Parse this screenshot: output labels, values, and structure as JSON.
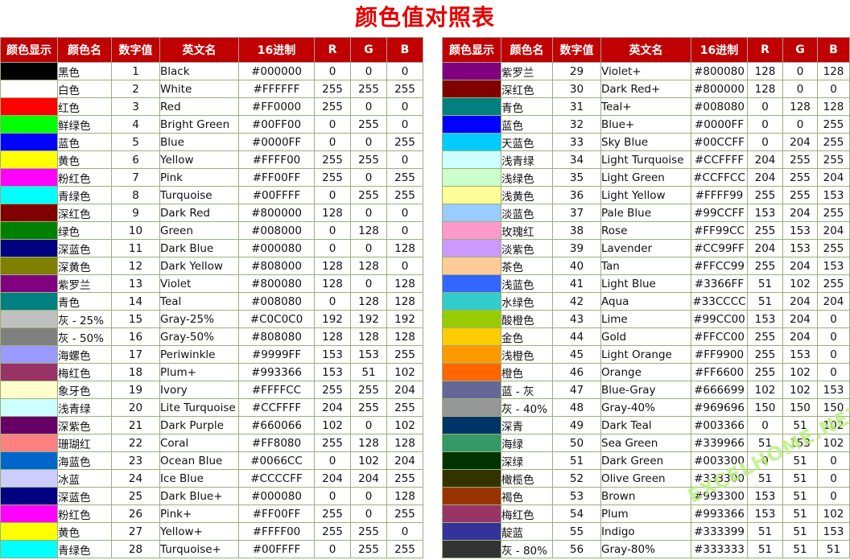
{
  "title": "颜色值对照表",
  "headers": [
    "颜色显示",
    "颜色名",
    "数字值",
    "英文名",
    "16进制",
    "R",
    "G",
    "B"
  ],
  "watermark": "EXCELHOME.NET",
  "rows": [
    {
      "name": "黑色",
      "num": "1",
      "en": "Black",
      "hex": "#000000",
      "r": "0",
      "g": "0",
      "b": "0",
      "color": "#000000"
    },
    {
      "name": "白色",
      "num": "2",
      "en": "White",
      "hex": "#FFFFFF",
      "r": "255",
      "g": "255",
      "b": "255",
      "color": "#FFFFFF"
    },
    {
      "name": "红色",
      "num": "3",
      "en": "Red",
      "hex": "#FF0000",
      "r": "255",
      "g": "0",
      "b": "0",
      "color": "#FF0000"
    },
    {
      "name": "鲜绿色",
      "num": "4",
      "en": "Bright Green",
      "hex": "#00FF00",
      "r": "0",
      "g": "255",
      "b": "0",
      "color": "#00FF00"
    },
    {
      "name": "蓝色",
      "num": "5",
      "en": "Blue",
      "hex": "#0000FF",
      "r": "0",
      "g": "0",
      "b": "255",
      "color": "#0000FF"
    },
    {
      "name": "黄色",
      "num": "6",
      "en": "Yellow",
      "hex": "#FFFF00",
      "r": "255",
      "g": "255",
      "b": "0",
      "color": "#FFFF00"
    },
    {
      "name": "粉红色",
      "num": "7",
      "en": "Pink",
      "hex": "#FF00FF",
      "r": "255",
      "g": "0",
      "b": "255",
      "color": "#FF00FF"
    },
    {
      "name": "青绿色",
      "num": "8",
      "en": "Turquoise",
      "hex": "#00FFFF",
      "r": "0",
      "g": "255",
      "b": "255",
      "color": "#00FFFF"
    },
    {
      "name": "深红色",
      "num": "9",
      "en": "Dark Red",
      "hex": "#800000",
      "r": "128",
      "g": "0",
      "b": "0",
      "color": "#800000"
    },
    {
      "name": "绿色",
      "num": "10",
      "en": "Green",
      "hex": "#008000",
      "r": "0",
      "g": "128",
      "b": "0",
      "color": "#008000"
    },
    {
      "name": "深蓝色",
      "num": "11",
      "en": "Dark Blue",
      "hex": "#000080",
      "r": "0",
      "g": "0",
      "b": "128",
      "color": "#000080"
    },
    {
      "name": "深黄色",
      "num": "12",
      "en": "Dark Yellow",
      "hex": "#808000",
      "r": "128",
      "g": "128",
      "b": "0",
      "color": "#808000"
    },
    {
      "name": "紫罗兰",
      "num": "13",
      "en": "Violet",
      "hex": "#800080",
      "r": "128",
      "g": "0",
      "b": "128",
      "color": "#800080"
    },
    {
      "name": "青色",
      "num": "14",
      "en": "Teal",
      "hex": "#008080",
      "r": "0",
      "g": "128",
      "b": "128",
      "color": "#008080"
    },
    {
      "name": "灰 - 25%",
      "num": "15",
      "en": "Gray-25%",
      "hex": "#C0C0C0",
      "r": "192",
      "g": "192",
      "b": "192",
      "color": "#C0C0C0"
    },
    {
      "name": "灰 - 50%",
      "num": "16",
      "en": "Gray-50%",
      "hex": "#808080",
      "r": "128",
      "g": "128",
      "b": "128",
      "color": "#808080"
    },
    {
      "name": "海螺色",
      "num": "17",
      "en": "Periwinkle",
      "hex": "#9999FF",
      "r": "153",
      "g": "153",
      "b": "255",
      "color": "#9999FF"
    },
    {
      "name": "梅红色",
      "num": "18",
      "en": "Plum+",
      "hex": "#993366",
      "r": "153",
      "g": "51",
      "b": "102",
      "color": "#993366"
    },
    {
      "name": "象牙色",
      "num": "19",
      "en": "Ivory",
      "hex": "#FFFFCC",
      "r": "255",
      "g": "255",
      "b": "204",
      "color": "#FFFFCC"
    },
    {
      "name": "浅青绿",
      "num": "20",
      "en": "Lite Turquoise",
      "hex": "#CCFFFF",
      "r": "204",
      "g": "255",
      "b": "255",
      "color": "#CCFFFF"
    },
    {
      "name": "深紫色",
      "num": "21",
      "en": "Dark Purple",
      "hex": "#660066",
      "r": "102",
      "g": "0",
      "b": "102",
      "color": "#660066"
    },
    {
      "name": "珊瑚红",
      "num": "22",
      "en": "Coral",
      "hex": "#FF8080",
      "r": "255",
      "g": "128",
      "b": "128",
      "color": "#FF8080"
    },
    {
      "name": "海蓝色",
      "num": "23",
      "en": "Ocean Blue",
      "hex": "#0066CC",
      "r": "0",
      "g": "102",
      "b": "204",
      "color": "#0066CC"
    },
    {
      "name": "冰蓝",
      "num": "24",
      "en": "Ice Blue",
      "hex": "#CCCCFF",
      "r": "204",
      "g": "204",
      "b": "255",
      "color": "#CCCCFF"
    },
    {
      "name": "深蓝色",
      "num": "25",
      "en": "Dark Blue+",
      "hex": "#000080",
      "r": "0",
      "g": "0",
      "b": "128",
      "color": "#000080"
    },
    {
      "name": "粉红色",
      "num": "26",
      "en": "Pink+",
      "hex": "#FF00FF",
      "r": "255",
      "g": "0",
      "b": "255",
      "color": "#FF00FF"
    },
    {
      "name": "黄色",
      "num": "27",
      "en": "Yellow+",
      "hex": "#FFFF00",
      "r": "255",
      "g": "255",
      "b": "0",
      "color": "#FFFF00"
    },
    {
      "name": "青绿色",
      "num": "28",
      "en": "Turquoise+",
      "hex": "#00FFFF",
      "r": "0",
      "g": "255",
      "b": "255",
      "color": "#00FFFF"
    },
    {
      "name": "紫罗兰",
      "num": "29",
      "en": "Violet+",
      "hex": "#800080",
      "r": "128",
      "g": "0",
      "b": "128",
      "color": "#800080"
    },
    {
      "name": "深红色",
      "num": "30",
      "en": "Dark Red+",
      "hex": "#800000",
      "r": "128",
      "g": "0",
      "b": "0",
      "color": "#800000"
    },
    {
      "name": "青色",
      "num": "31",
      "en": "Teal+",
      "hex": "#008080",
      "r": "0",
      "g": "128",
      "b": "128",
      "color": "#008080"
    },
    {
      "name": "蓝色",
      "num": "32",
      "en": "Blue+",
      "hex": "#0000FF",
      "r": "0",
      "g": "0",
      "b": "255",
      "color": "#0000FF"
    },
    {
      "name": "天蓝色",
      "num": "33",
      "en": "Sky Blue",
      "hex": "#00CCFF",
      "r": "0",
      "g": "204",
      "b": "255",
      "color": "#00CCFF"
    },
    {
      "name": "浅青绿",
      "num": "34",
      "en": "Light Turquoise",
      "hex": "#CCFFFF",
      "r": "204",
      "g": "255",
      "b": "255",
      "color": "#CCFFFF"
    },
    {
      "name": "浅绿色",
      "num": "35",
      "en": "Light Green",
      "hex": "#CCFFCC",
      "r": "204",
      "g": "255",
      "b": "204",
      "color": "#CCFFCC"
    },
    {
      "name": "浅黄色",
      "num": "36",
      "en": "Light Yellow",
      "hex": "#FFFF99",
      "r": "255",
      "g": "255",
      "b": "153",
      "color": "#FFFF99"
    },
    {
      "name": "淡蓝色",
      "num": "37",
      "en": "Pale Blue",
      "hex": "#99CCFF",
      "r": "153",
      "g": "204",
      "b": "255",
      "color": "#99CCFF"
    },
    {
      "name": "玫瑰红",
      "num": "38",
      "en": "Rose",
      "hex": "#FF99CC",
      "r": "255",
      "g": "153",
      "b": "204",
      "color": "#FF99CC"
    },
    {
      "name": "淡紫色",
      "num": "39",
      "en": "Lavender",
      "hex": "#CC99FF",
      "r": "204",
      "g": "153",
      "b": "255",
      "color": "#CC99FF"
    },
    {
      "name": "茶色",
      "num": "40",
      "en": "Tan",
      "hex": "#FFCC99",
      "r": "255",
      "g": "204",
      "b": "153",
      "color": "#FFCC99"
    },
    {
      "name": "浅蓝色",
      "num": "41",
      "en": "Light Blue",
      "hex": "#3366FF",
      "r": "51",
      "g": "102",
      "b": "255",
      "color": "#3366FF"
    },
    {
      "name": "水绿色",
      "num": "42",
      "en": "Aqua",
      "hex": "#33CCCC",
      "r": "51",
      "g": "204",
      "b": "204",
      "color": "#33CCCC"
    },
    {
      "name": "酸橙色",
      "num": "43",
      "en": "Lime",
      "hex": "#99CC00",
      "r": "153",
      "g": "204",
      "b": "0",
      "color": "#99CC00"
    },
    {
      "name": "金色",
      "num": "44",
      "en": "Gold",
      "hex": "#FFCC00",
      "r": "255",
      "g": "204",
      "b": "0",
      "color": "#FFCC00"
    },
    {
      "name": "浅橙色",
      "num": "45",
      "en": "Light Orange",
      "hex": "#FF9900",
      "r": "255",
      "g": "153",
      "b": "0",
      "color": "#FF9900"
    },
    {
      "name": "橙色",
      "num": "46",
      "en": "Orange",
      "hex": "#FF6600",
      "r": "255",
      "g": "102",
      "b": "0",
      "color": "#FF6600"
    },
    {
      "name": "蓝 - 灰",
      "num": "47",
      "en": "Blue-Gray",
      "hex": "#666699",
      "r": "102",
      "g": "102",
      "b": "153",
      "color": "#666699"
    },
    {
      "name": "灰 - 40%",
      "num": "48",
      "en": "Gray-40%",
      "hex": "#969696",
      "r": "150",
      "g": "150",
      "b": "150",
      "color": "#969696"
    },
    {
      "name": "深青",
      "num": "49",
      "en": "Dark Teal",
      "hex": "#003366",
      "r": "0",
      "g": "51",
      "b": "102",
      "color": "#003366"
    },
    {
      "name": "海绿",
      "num": "50",
      "en": "Sea Green",
      "hex": "#339966",
      "r": "51",
      "g": "153",
      "b": "102",
      "color": "#339966"
    },
    {
      "name": "深绿",
      "num": "51",
      "en": "Dark Green",
      "hex": "#003300",
      "r": "0",
      "g": "51",
      "b": "0",
      "color": "#003300"
    },
    {
      "name": "橄榄色",
      "num": "52",
      "en": "Olive Green",
      "hex": "#333300",
      "r": "51",
      "g": "51",
      "b": "0",
      "color": "#333300"
    },
    {
      "name": "褐色",
      "num": "53",
      "en": "Brown",
      "hex": "#993300",
      "r": "153",
      "g": "51",
      "b": "0",
      "color": "#993300"
    },
    {
      "name": "梅红色",
      "num": "54",
      "en": "Plum",
      "hex": "#993366",
      "r": "153",
      "g": "51",
      "b": "102",
      "color": "#993366"
    },
    {
      "name": "靛蓝",
      "num": "55",
      "en": "Indigo",
      "hex": "#333399",
      "r": "51",
      "g": "51",
      "b": "153",
      "color": "#333399"
    },
    {
      "name": "灰 - 80%",
      "num": "56",
      "en": "Gray-80%",
      "hex": "#333333",
      "r": "51",
      "g": "51",
      "b": "51",
      "color": "#333333"
    }
  ]
}
